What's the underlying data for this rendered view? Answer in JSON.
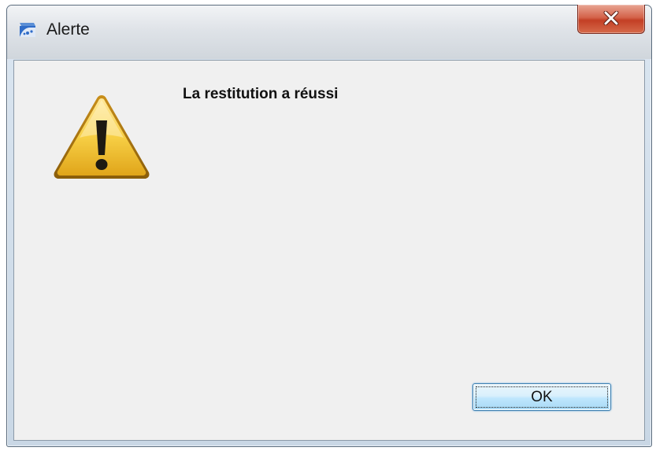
{
  "window": {
    "title": "Alerte",
    "app_icon": "app-icon",
    "close_icon": "close-icon"
  },
  "dialog": {
    "icon": "warning-icon",
    "message": "La restitution a réussi",
    "ok_label": "OK"
  },
  "colors": {
    "close_button": "#c84a30",
    "ok_button_border": "#3c7fb1",
    "dialog_background": "#f0f0f0",
    "warning_fill": "#f2c53d"
  }
}
